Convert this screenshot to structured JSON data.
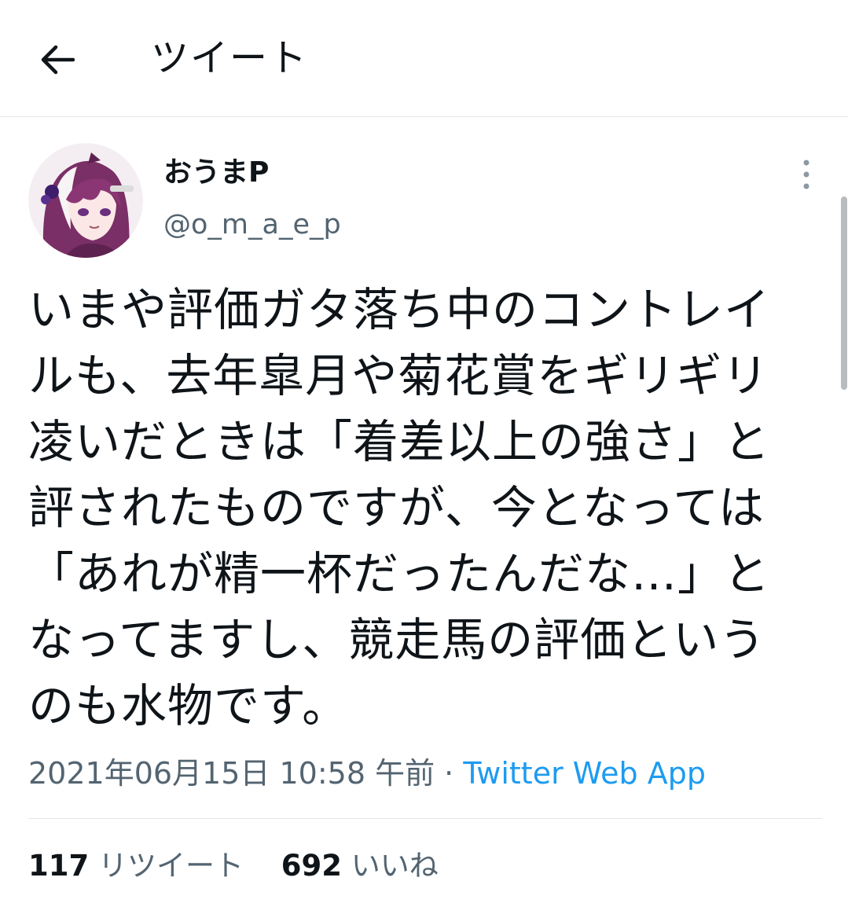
{
  "header": {
    "title": "ツイート",
    "back_icon": "arrow-left-icon"
  },
  "author": {
    "display_name": "おうまP",
    "handle": "@o_m_a_e_p",
    "avatar_icon": "avatar-illustration"
  },
  "tweet": {
    "lines": [
      "いまや評価ガタ落ち中のコントレイ",
      "ルも、去年皐月や菊花賞をギリギリ",
      "凌いだときは「着差以上の強さ」と",
      "評されたものですが、今となっては",
      "「あれが精一杯だったんだな…」と",
      "なってますし、競走馬の評価という",
      "のも水物です。"
    ],
    "timestamp": "2021年06月15日 10:58 午前",
    "separator": " · ",
    "source": "Twitter Web App"
  },
  "stats": {
    "retweets_count": "117",
    "retweets_label": "リツイート",
    "likes_count": "692",
    "likes_label": "いいね"
  },
  "colors": {
    "text": "#0f1419",
    "secondary": "#536471",
    "link": "#1d9bf0",
    "border": "#e1e6ea"
  }
}
